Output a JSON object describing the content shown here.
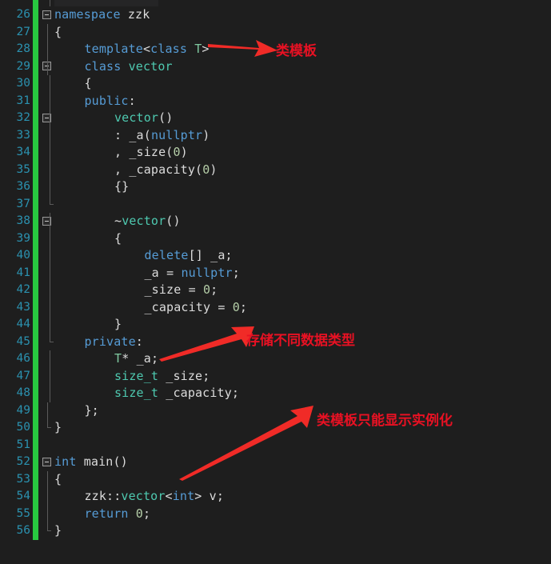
{
  "editor": {
    "theme": "dark",
    "background_color": "#1e1e1e",
    "line_number_color": "#2b91af",
    "change_bar_color": "#28c940",
    "first_visible_line": 26,
    "last_visible_line": 56,
    "language": "C++"
  },
  "lines": [
    {
      "num": "26",
      "indent": 0,
      "fold": true,
      "guide": "none",
      "text": "namespace zzk"
    },
    {
      "num": "27",
      "indent": 0,
      "fold": false,
      "guide": "g1",
      "text": "{"
    },
    {
      "num": "28",
      "indent": 1,
      "fold": false,
      "guide": "g1",
      "text": "template<class T>"
    },
    {
      "num": "29",
      "indent": 1,
      "fold": true,
      "guide": "g1",
      "text": "class vector"
    },
    {
      "num": "30",
      "indent": 1,
      "fold": false,
      "guide": "g2",
      "text": "{"
    },
    {
      "num": "31",
      "indent": 1,
      "fold": false,
      "guide": "g2",
      "text": "public:"
    },
    {
      "num": "32",
      "indent": 2,
      "fold": true,
      "guide": "g2",
      "text": "vector()"
    },
    {
      "num": "33",
      "indent": 2,
      "fold": false,
      "guide": "g2",
      "text": ": _a(nullptr)"
    },
    {
      "num": "34",
      "indent": 2,
      "fold": false,
      "guide": "g2",
      "text": ", _size(0)"
    },
    {
      "num": "35",
      "indent": 2,
      "fold": false,
      "guide": "g2",
      "text": ", _capacity(0)"
    },
    {
      "num": "36",
      "indent": 2,
      "fold": false,
      "guide": "g2",
      "text": "{}"
    },
    {
      "num": "37",
      "indent": 0,
      "fold": false,
      "guide": "g2end",
      "text": ""
    },
    {
      "num": "38",
      "indent": 2,
      "fold": true,
      "guide": "g2",
      "text": "~vector()"
    },
    {
      "num": "39",
      "indent": 2,
      "fold": false,
      "guide": "g2",
      "text": "{"
    },
    {
      "num": "40",
      "indent": 3,
      "fold": false,
      "guide": "g2",
      "text": "delete[] _a;"
    },
    {
      "num": "41",
      "indent": 3,
      "fold": false,
      "guide": "g2",
      "text": "_a = nullptr;"
    },
    {
      "num": "42",
      "indent": 3,
      "fold": false,
      "guide": "g2",
      "text": "_size = 0;"
    },
    {
      "num": "43",
      "indent": 3,
      "fold": false,
      "guide": "g2",
      "text": "_capacity = 0;"
    },
    {
      "num": "44",
      "indent": 2,
      "fold": false,
      "guide": "g2",
      "text": "}"
    },
    {
      "num": "45",
      "indent": 1,
      "fold": false,
      "guide": "g2end",
      "text": "private:"
    },
    {
      "num": "46",
      "indent": 2,
      "fold": false,
      "guide": "g2",
      "text": "T* _a;"
    },
    {
      "num": "47",
      "indent": 2,
      "fold": false,
      "guide": "g2",
      "text": "size_t _size;"
    },
    {
      "num": "48",
      "indent": 2,
      "fold": false,
      "guide": "g2",
      "text": "size_t _capacity;"
    },
    {
      "num": "49",
      "indent": 1,
      "fold": false,
      "guide": "g1",
      "text": "};"
    },
    {
      "num": "50",
      "indent": 0,
      "fold": false,
      "guide": "g1end",
      "text": "}"
    },
    {
      "num": "51",
      "indent": 0,
      "fold": false,
      "guide": "none",
      "text": ""
    },
    {
      "num": "52",
      "indent": 0,
      "fold": true,
      "guide": "none",
      "text": "int main()"
    },
    {
      "num": "53",
      "indent": 0,
      "fold": false,
      "guide": "g1",
      "text": "{"
    },
    {
      "num": "54",
      "indent": 1,
      "fold": false,
      "guide": "g1",
      "text": "zzk::vector<int> v;"
    },
    {
      "num": "55",
      "indent": 1,
      "fold": false,
      "guide": "g1",
      "text": "return 0;"
    },
    {
      "num": "56",
      "indent": 0,
      "fold": false,
      "guide": "g1end",
      "text": "}"
    }
  ],
  "annotations": [
    {
      "id": "anno-class-template",
      "text": "类模板",
      "color": "#e81123"
    },
    {
      "id": "anno-store-data-types",
      "text": "存储不同数据类型",
      "color": "#e81123"
    },
    {
      "id": "anno-explicit-instantiation",
      "text": "类模板只能显示实例化",
      "color": "#e81123"
    }
  ]
}
